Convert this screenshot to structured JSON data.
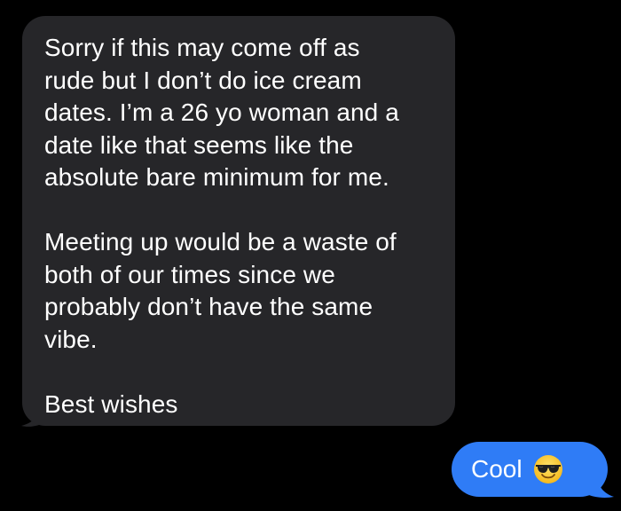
{
  "colors": {
    "background": "#000000",
    "received_bubble": "#262629",
    "sent_bubble": "#2f7cf6",
    "text": "#ffffff"
  },
  "received_message": {
    "paragraph_1": "Sorry if this may come off as\nrude but I don’t do ice cream\ndates. I’m a 26 yo woman and a\ndate like that seems like the\nabsolute bare minimum for me.",
    "paragraph_2": "Meeting up would be a waste of\nboth of our times since we\nprobably don’t have the same\nvibe.",
    "paragraph_3": "Best wishes"
  },
  "sent_message": {
    "text": "Cool",
    "emoji": "smiling-face-with-sunglasses-icon"
  }
}
